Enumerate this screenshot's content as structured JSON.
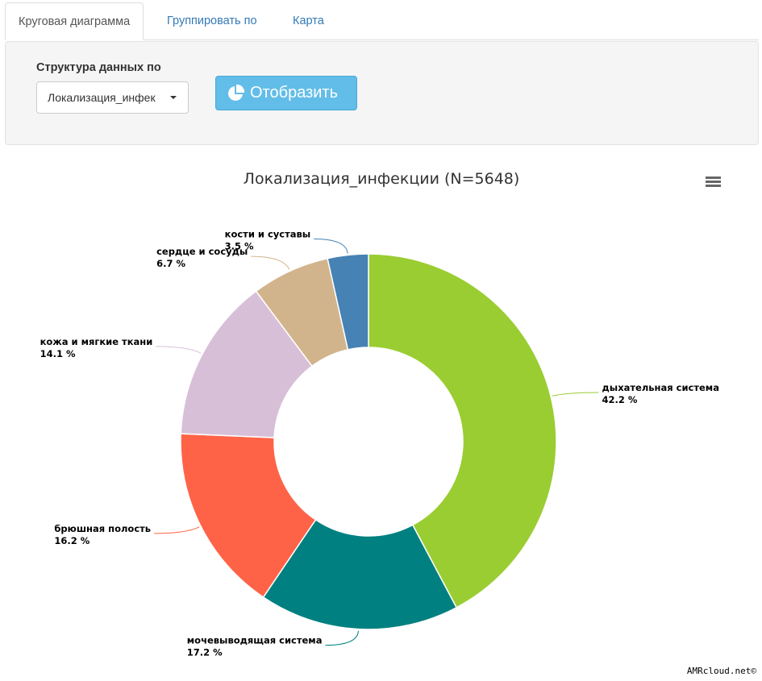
{
  "tabs": [
    {
      "label": "Круговая диаграмма"
    },
    {
      "label": "Группировать по"
    },
    {
      "label": "Карта"
    }
  ],
  "controls": {
    "structure_label": "Структура данных по",
    "dropdown_value": "Локализация_инфек",
    "show_button_label": "Отобразить",
    "show_button_icon": "pie-chart-icon"
  },
  "chart_menu_icon": "hamburger-menu-icon",
  "credits": "AMRcloud.net©",
  "colors": {
    "tab_link": "#337ab7",
    "button": "#62bde8"
  },
  "chart_data": {
    "type": "pie",
    "title": "Локализация_инфекции (N=5648)",
    "donut": true,
    "slices": [
      {
        "label": "дыхательная система",
        "value": 42.2,
        "value_label": "42.2 %",
        "color": "#9acd32"
      },
      {
        "label": "мочевыводящая система",
        "value": 17.2,
        "value_label": "17.2 %",
        "color": "#008080"
      },
      {
        "label": "брюшная полость",
        "value": 16.2,
        "value_label": "16.2 %",
        "color": "#ff6347"
      },
      {
        "label": "кожа и мягкие ткани",
        "value": 14.1,
        "value_label": "14.1 %",
        "color": "#d8bfd8"
      },
      {
        "label": "сердце и сосуды",
        "value": 6.7,
        "value_label": "6.7 %",
        "color": "#d2b48c"
      },
      {
        "label": "кости и суставы",
        "value": 3.5,
        "value_label": "3.5 %",
        "color": "#4682b4"
      }
    ]
  }
}
